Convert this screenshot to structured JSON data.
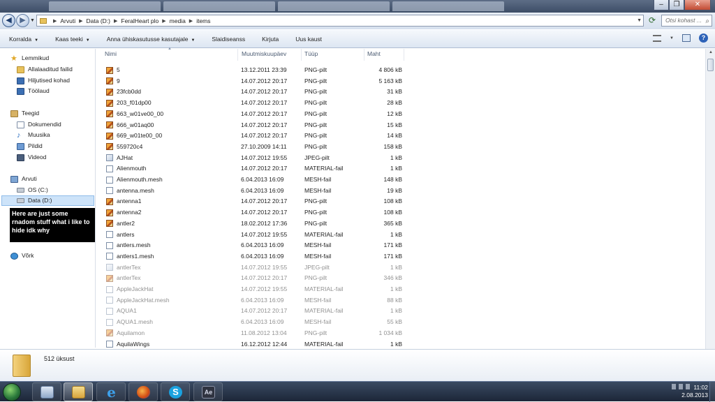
{
  "window": {
    "address": {
      "crumbs": [
        "Arvuti",
        "Data (D:)",
        "FeralHeart plo",
        "media",
        "items"
      ]
    },
    "search_placeholder": "Otsi kohast ..."
  },
  "toolbar": {
    "organize": "Korralda",
    "share": "Kaas teeki",
    "share_with": "Anna ühiskasutusse kasutajale",
    "slideshow": "Slaidiseanss",
    "burn": "Kirjuta",
    "new_folder": "Uus kaust"
  },
  "nav": {
    "favorites": "Lemmikud",
    "downloads": "Allalaaditud failid",
    "recent": "Hiljutised kohad",
    "desktop": "Töölaud",
    "libraries": "Teegid",
    "documents": "Dokumendid",
    "music": "Muusika",
    "pictures": "Pildid",
    "videos": "Videod",
    "computer": "Arvuti",
    "drive_c": "OS (C:)",
    "drive_d": "Data (D:)",
    "network": "Võrk"
  },
  "annotation": "Here are just some rnadom stuff what i like to hide idk why",
  "columns": {
    "name": "Nimi",
    "date": "Muutmiskuupäev",
    "type": "Tüüp",
    "size": "Maht"
  },
  "files": [
    {
      "name": "5",
      "date": "13.12.2011 23:39",
      "type": "PNG-pilt",
      "size": "4 806 kB",
      "icon": "png",
      "hidden": false
    },
    {
      "name": "9",
      "date": "14.07.2012 20:17",
      "type": "PNG-pilt",
      "size": "5 163 kB",
      "icon": "png",
      "hidden": false
    },
    {
      "name": "23fcb0dd",
      "date": "14.07.2012 20:17",
      "type": "PNG-pilt",
      "size": "31 kB",
      "icon": "png",
      "hidden": false
    },
    {
      "name": "203_f01dp00",
      "date": "14.07.2012 20:17",
      "type": "PNG-pilt",
      "size": "28 kB",
      "icon": "png",
      "hidden": false
    },
    {
      "name": "663_w01ve00_00",
      "date": "14.07.2012 20:17",
      "type": "PNG-pilt",
      "size": "12 kB",
      "icon": "png",
      "hidden": false
    },
    {
      "name": "666_w01aq00",
      "date": "14.07.2012 20:17",
      "type": "PNG-pilt",
      "size": "15 kB",
      "icon": "png",
      "hidden": false
    },
    {
      "name": "669_w01te00_00",
      "date": "14.07.2012 20:17",
      "type": "PNG-pilt",
      "size": "14 kB",
      "icon": "png",
      "hidden": false
    },
    {
      "name": "559720c4",
      "date": "27.10.2009 14:11",
      "type": "PNG-pilt",
      "size": "158 kB",
      "icon": "png",
      "hidden": false
    },
    {
      "name": "AJHat",
      "date": "14.07.2012 19:55",
      "type": "JPEG-pilt",
      "size": "1 kB",
      "icon": "jpg",
      "hidden": false
    },
    {
      "name": "Alienmouth",
      "date": "14.07.2012 20:17",
      "type": "MATERIAL-fail",
      "size": "1 kB",
      "icon": "file",
      "hidden": false
    },
    {
      "name": "Alienmouth.mesh",
      "date": "6.04.2013 16:09",
      "type": "MESH-fail",
      "size": "148 kB",
      "icon": "file",
      "hidden": false
    },
    {
      "name": "antenna.mesh",
      "date": "6.04.2013 16:09",
      "type": "MESH-fail",
      "size": "19 kB",
      "icon": "file",
      "hidden": false
    },
    {
      "name": "antenna1",
      "date": "14.07.2012 20:17",
      "type": "PNG-pilt",
      "size": "108 kB",
      "icon": "png",
      "hidden": false
    },
    {
      "name": "antenna2",
      "date": "14.07.2012 20:17",
      "type": "PNG-pilt",
      "size": "108 kB",
      "icon": "png",
      "hidden": false
    },
    {
      "name": "antler2",
      "date": "18.02.2012 17:36",
      "type": "PNG-pilt",
      "size": "365 kB",
      "icon": "png",
      "hidden": false
    },
    {
      "name": "antlers",
      "date": "14.07.2012 19:55",
      "type": "MATERIAL-fail",
      "size": "1 kB",
      "icon": "file",
      "hidden": false
    },
    {
      "name": "antlers.mesh",
      "date": "6.04.2013 16:09",
      "type": "MESH-fail",
      "size": "171 kB",
      "icon": "file",
      "hidden": false
    },
    {
      "name": "antlers1.mesh",
      "date": "6.04.2013 16:09",
      "type": "MESH-fail",
      "size": "171 kB",
      "icon": "file",
      "hidden": false
    },
    {
      "name": "antlerTex",
      "date": "14.07.2012 19:55",
      "type": "JPEG-pilt",
      "size": "1 kB",
      "icon": "jpg",
      "hidden": true
    },
    {
      "name": "antlerTex",
      "date": "14.07.2012 20:17",
      "type": "PNG-pilt",
      "size": "346 kB",
      "icon": "png",
      "hidden": true
    },
    {
      "name": "AppleJackHat",
      "date": "14.07.2012 19:55",
      "type": "MATERIAL-fail",
      "size": "1 kB",
      "icon": "file",
      "hidden": true
    },
    {
      "name": "AppleJackHat.mesh",
      "date": "6.04.2013 16:09",
      "type": "MESH-fail",
      "size": "88 kB",
      "icon": "file",
      "hidden": true
    },
    {
      "name": "AQUA1",
      "date": "14.07.2012 20:17",
      "type": "MATERIAL-fail",
      "size": "1 kB",
      "icon": "file",
      "hidden": true
    },
    {
      "name": "AQUA1.mesh",
      "date": "6.04.2013 16:09",
      "type": "MESH-fail",
      "size": "55 kB",
      "icon": "file",
      "hidden": true
    },
    {
      "name": "Aquilamon",
      "date": "11.08.2012 13:04",
      "type": "PNG-pilt",
      "size": "1 034 kB",
      "icon": "png",
      "hidden": true
    },
    {
      "name": "AquilaWings",
      "date": "16.12.2012 12:44",
      "type": "MATERIAL-fail",
      "size": "1 kB",
      "icon": "file",
      "hidden": false
    }
  ],
  "details": {
    "count": "512 üksust"
  },
  "clock": {
    "time": "11:02",
    "date": "2.08.2013"
  }
}
